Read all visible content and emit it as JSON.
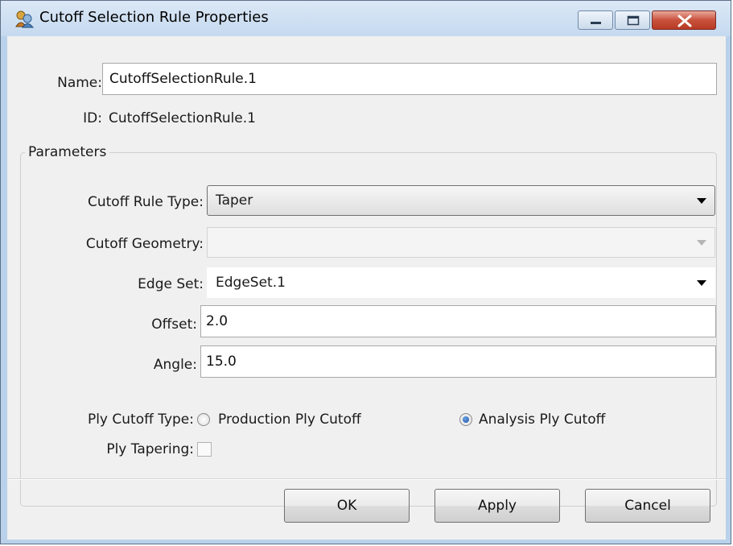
{
  "window": {
    "title": "Cutoff Selection Rule Properties",
    "icon": "cutoff-rule-app-icon"
  },
  "header": {
    "name_label": "Name:",
    "name_value": "CutoffSelectionRule.1",
    "id_label": "ID:",
    "id_value": "CutoffSelectionRule.1"
  },
  "parameters": {
    "group_title": "Parameters",
    "cutoff_rule_type": {
      "label": "Cutoff Rule Type:",
      "value": "Taper"
    },
    "cutoff_geometry": {
      "label": "Cutoff Geometry:",
      "value": ""
    },
    "edge_set": {
      "label": "Edge Set:",
      "value": "EdgeSet.1"
    },
    "offset": {
      "label": "Offset:",
      "value": "2.0"
    },
    "angle": {
      "label": "Angle:",
      "value": "15.0"
    },
    "ply_cutoff_type": {
      "label": "Ply Cutoff Type:",
      "options": [
        "Production Ply Cutoff",
        "Analysis Ply Cutoff"
      ],
      "selected": "Analysis Ply Cutoff"
    },
    "ply_tapering": {
      "label": "Ply Tapering:",
      "checked": false
    }
  },
  "buttons": {
    "ok": "OK",
    "apply": "Apply",
    "cancel": "Cancel"
  }
}
